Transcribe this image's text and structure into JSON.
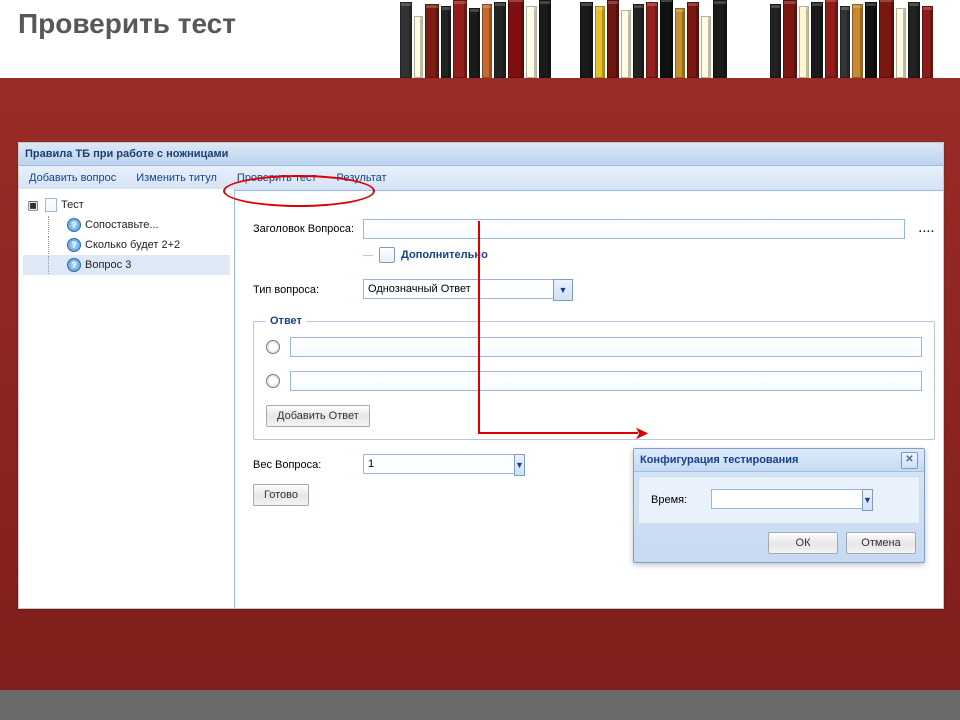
{
  "slide": {
    "title": "Проверить тест"
  },
  "app": {
    "title": "Правила ТБ при работе с ножницами",
    "toolbar": [
      "Добавить вопрос",
      "Изменить титул",
      "Проверить тест",
      "Результат"
    ],
    "tree": {
      "root": "Тест",
      "items": [
        "Сопоставьте...",
        "Сколько будет 2+2",
        "Вопрос 3"
      ],
      "selected_index": 2
    },
    "form": {
      "question_title_label": "Заголовок Вопроса:",
      "question_title_value": "",
      "more_button": "....",
      "extra_checkbox_label": "Дополнительно",
      "question_type_label": "Тип вопроса:",
      "question_type_value": "Однозначный Ответ",
      "answer_legend": "Ответ",
      "answer_options": [
        "",
        ""
      ],
      "add_answer_button": "Добавить Ответ",
      "weight_label": "Вес Вопроса:",
      "weight_value": "1",
      "done_button": "Готово"
    },
    "dialog": {
      "title": "Конфигурация тестирования",
      "time_label": "Время:",
      "time_value": "",
      "ok": "ОК",
      "cancel": "Отмена"
    }
  }
}
